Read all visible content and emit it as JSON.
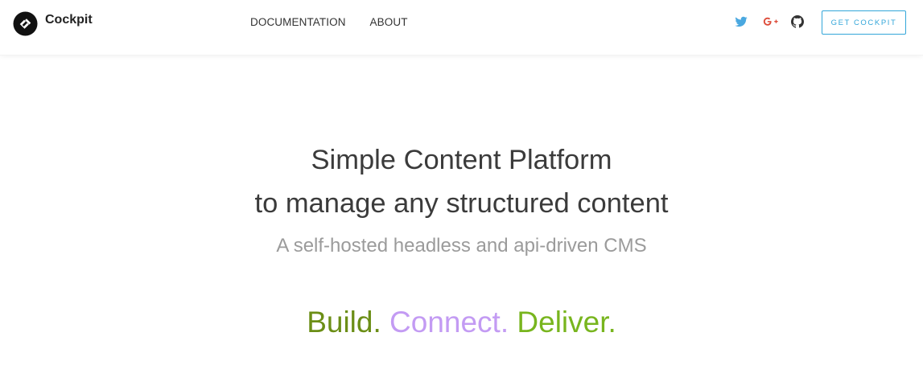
{
  "header": {
    "brand": "Cockpit",
    "nav": [
      "DOCUMENTATION",
      "ABOUT"
    ],
    "social_icons": [
      "twitter-icon",
      "google-plus-icon",
      "github-icon"
    ],
    "cta_label": "GET COCKPIT"
  },
  "hero": {
    "headline_line1": "Simple Content Platform",
    "headline_line2": "to manage any structured content",
    "subtitle": "A self-hosted headless and api-driven CMS",
    "tagline": {
      "build": "Build.",
      "connect": "Connect.",
      "deliver": "Deliver."
    }
  },
  "colors": {
    "accent": "#33a6d9",
    "twitter": "#4aa8e0",
    "google_plus": "#dd4b39",
    "github": "#333333",
    "build": "#6b8e16",
    "connect": "#c39bf3",
    "deliver": "#78b51e",
    "headline": "#3b3b3b",
    "subtitle": "#9b9b9b"
  }
}
